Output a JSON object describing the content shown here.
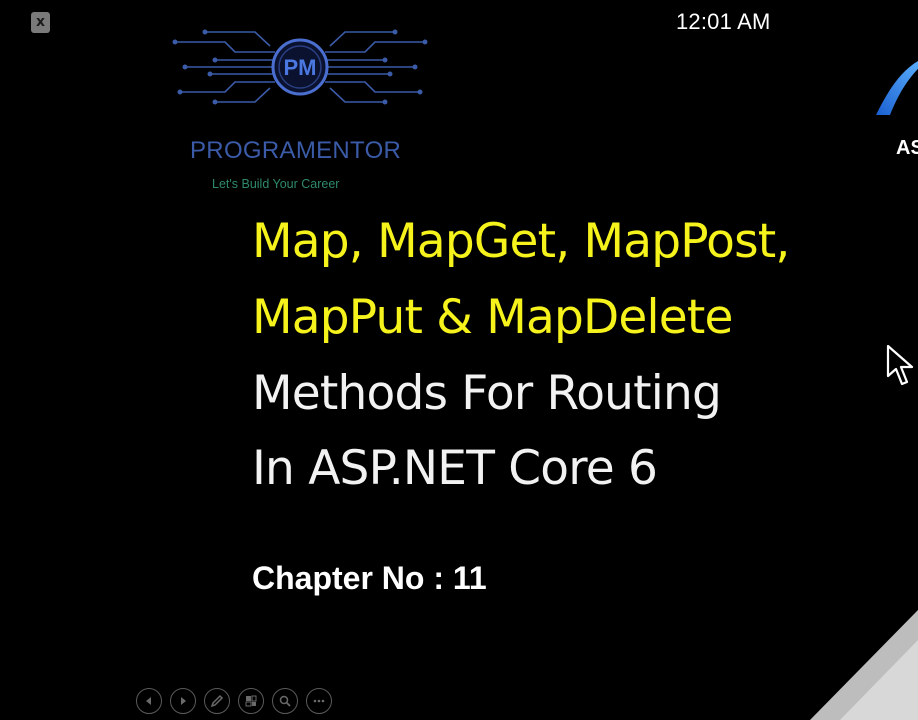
{
  "window": {
    "close_label": "x",
    "time": "12:01 AM"
  },
  "brand": {
    "logo_initials": "PM",
    "name": "PROGRAMENTOR",
    "tagline": "Let's Build Your Career",
    "partner_text": "AS"
  },
  "slide": {
    "title_lines": [
      "Map, MapGet, MapPost,",
      "MapPut & MapDelete",
      "Methods For Routing",
      "In ASP.NET Core 6"
    ],
    "chapter": "Chapter No : 11"
  },
  "colors": {
    "background": "#000000",
    "title_highlight": "#f6f31c",
    "title_plain": "#f2f2f2",
    "brand_blue": "#3b5ba8",
    "tagline_green": "#2f8a6a"
  },
  "controls": [
    {
      "icon": "previous-icon"
    },
    {
      "icon": "next-icon"
    },
    {
      "icon": "pen-icon"
    },
    {
      "icon": "slides-icon"
    },
    {
      "icon": "zoom-icon"
    },
    {
      "icon": "more-icon"
    }
  ]
}
